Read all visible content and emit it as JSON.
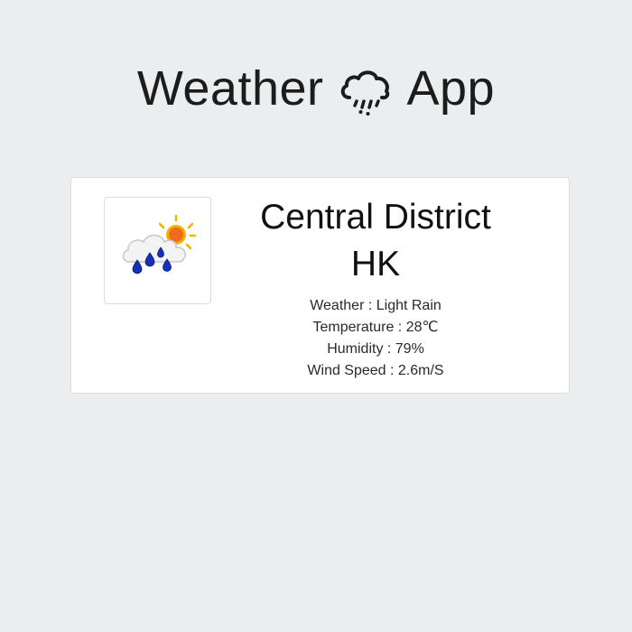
{
  "header": {
    "title_left": "Weather",
    "icon": "rain-cloud-icon",
    "title_right": "App"
  },
  "card": {
    "weather_image_icon": "cloud-sun-rain-icon",
    "city_line1": "Central District",
    "city_line2": "HK",
    "weather": "Weather : Light Rain",
    "temperature": "Temperature : 28℃",
    "humidity": "Humidity : 79%",
    "wind": "Wind Speed : 2.6m/S"
  },
  "colors": {
    "background": "#ecedee",
    "card": "#ffffff",
    "border": "#dcdcdc",
    "rain_drop": "#1531b8",
    "sun": "#f5b100"
  }
}
